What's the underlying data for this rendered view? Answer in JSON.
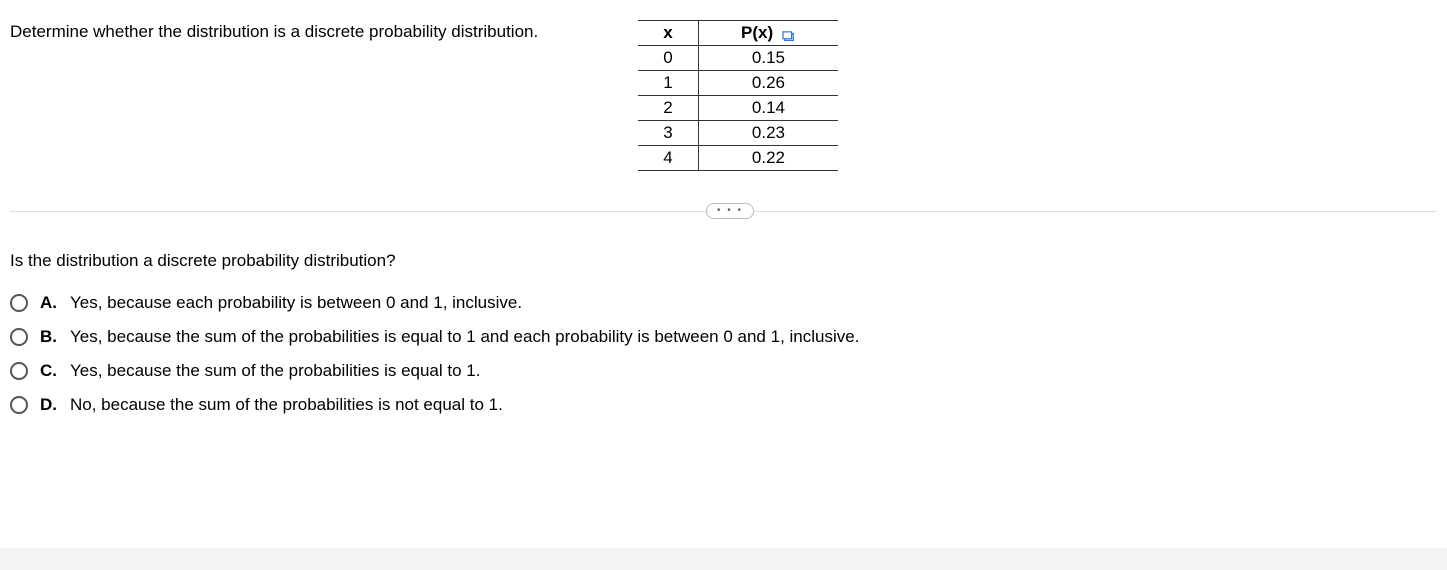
{
  "question": "Determine whether the distribution is a discrete probability distribution.",
  "table": {
    "headers": {
      "x": "x",
      "px": "P(x)"
    },
    "rows": [
      {
        "x": "0",
        "px": "0.15"
      },
      {
        "x": "1",
        "px": "0.26"
      },
      {
        "x": "2",
        "px": "0.14"
      },
      {
        "x": "3",
        "px": "0.23"
      },
      {
        "x": "4",
        "px": "0.22"
      }
    ]
  },
  "sub_question": "Is the distribution a discrete probability distribution?",
  "options": [
    {
      "letter": "A.",
      "text": "Yes, because each probability is between 0 and 1, inclusive."
    },
    {
      "letter": "B.",
      "text": "Yes, because the sum of the probabilities is equal to 1 and each probability is between 0 and 1, inclusive."
    },
    {
      "letter": "C.",
      "text": "Yes, because the sum of the probabilities is equal to 1."
    },
    {
      "letter": "D.",
      "text": "No, because the sum of the probabilities is not equal to 1."
    }
  ],
  "dots": "• • •"
}
